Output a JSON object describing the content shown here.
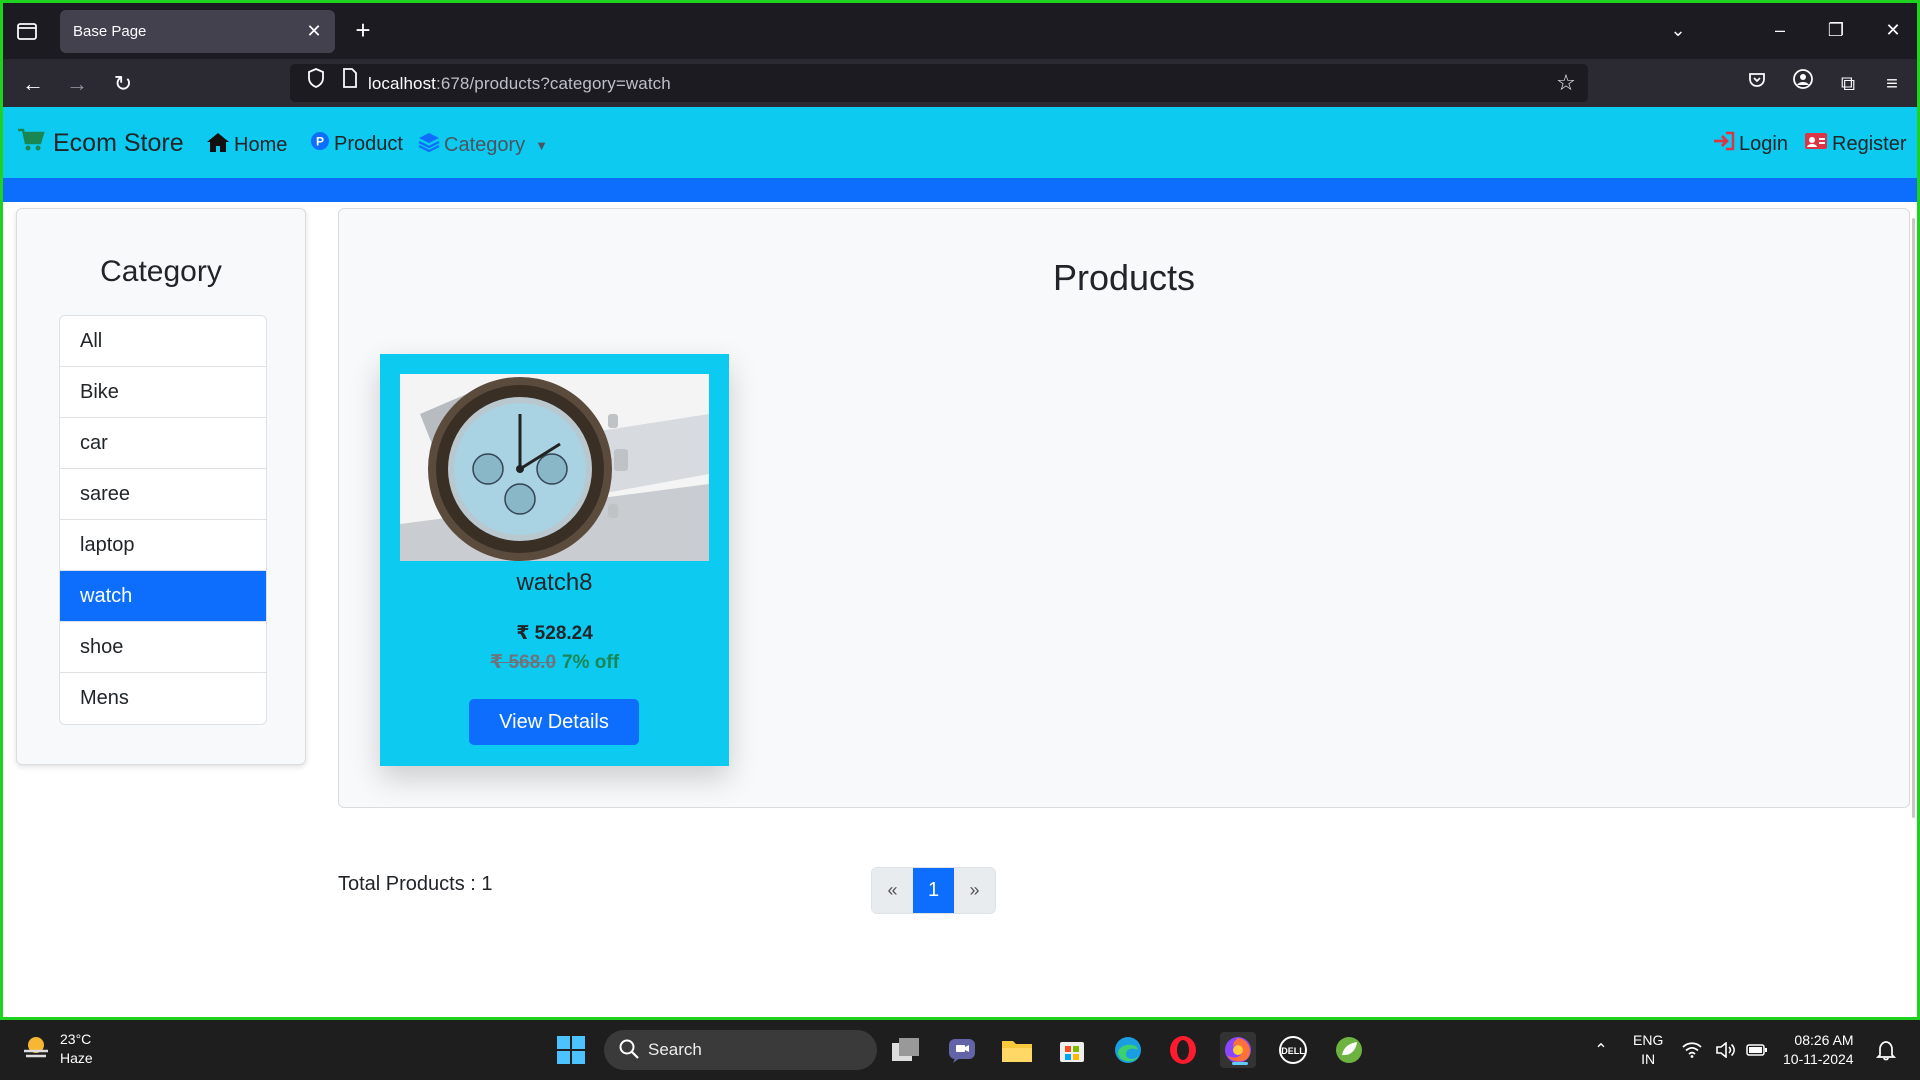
{
  "browser": {
    "tab_title": "Base Page",
    "url_host": "localhost",
    "url_rest": ":678/products?category=watch"
  },
  "navbar": {
    "brand": "Ecom Store",
    "links": [
      "Home",
      "Product",
      "Category"
    ],
    "login": "Login",
    "register": "Register"
  },
  "sidebar": {
    "title": "Category",
    "categories": [
      "All",
      "Bike",
      "car",
      "saree",
      "laptop",
      "watch",
      "shoe",
      "Mens"
    ],
    "active": "watch"
  },
  "products": {
    "title": "Products",
    "items": [
      {
        "name": "watch8",
        "price": "₹ 528.24",
        "old_price": "₹ 568.0",
        "discount": "7% off",
        "button": "View Details"
      }
    ],
    "total_label": "Total Products : 1"
  },
  "pagination": {
    "prev": "«",
    "current": "1",
    "next": "»"
  },
  "taskbar": {
    "temperature": "23°C",
    "weather": "Haze",
    "search": "Search",
    "lang_line1": "ENG",
    "lang_line2": "IN",
    "time": "08:26 AM",
    "date": "10-11-2024"
  },
  "colors": {
    "navbar": "#0dcaf0",
    "primary": "#0d6efd",
    "success": "#198754"
  }
}
